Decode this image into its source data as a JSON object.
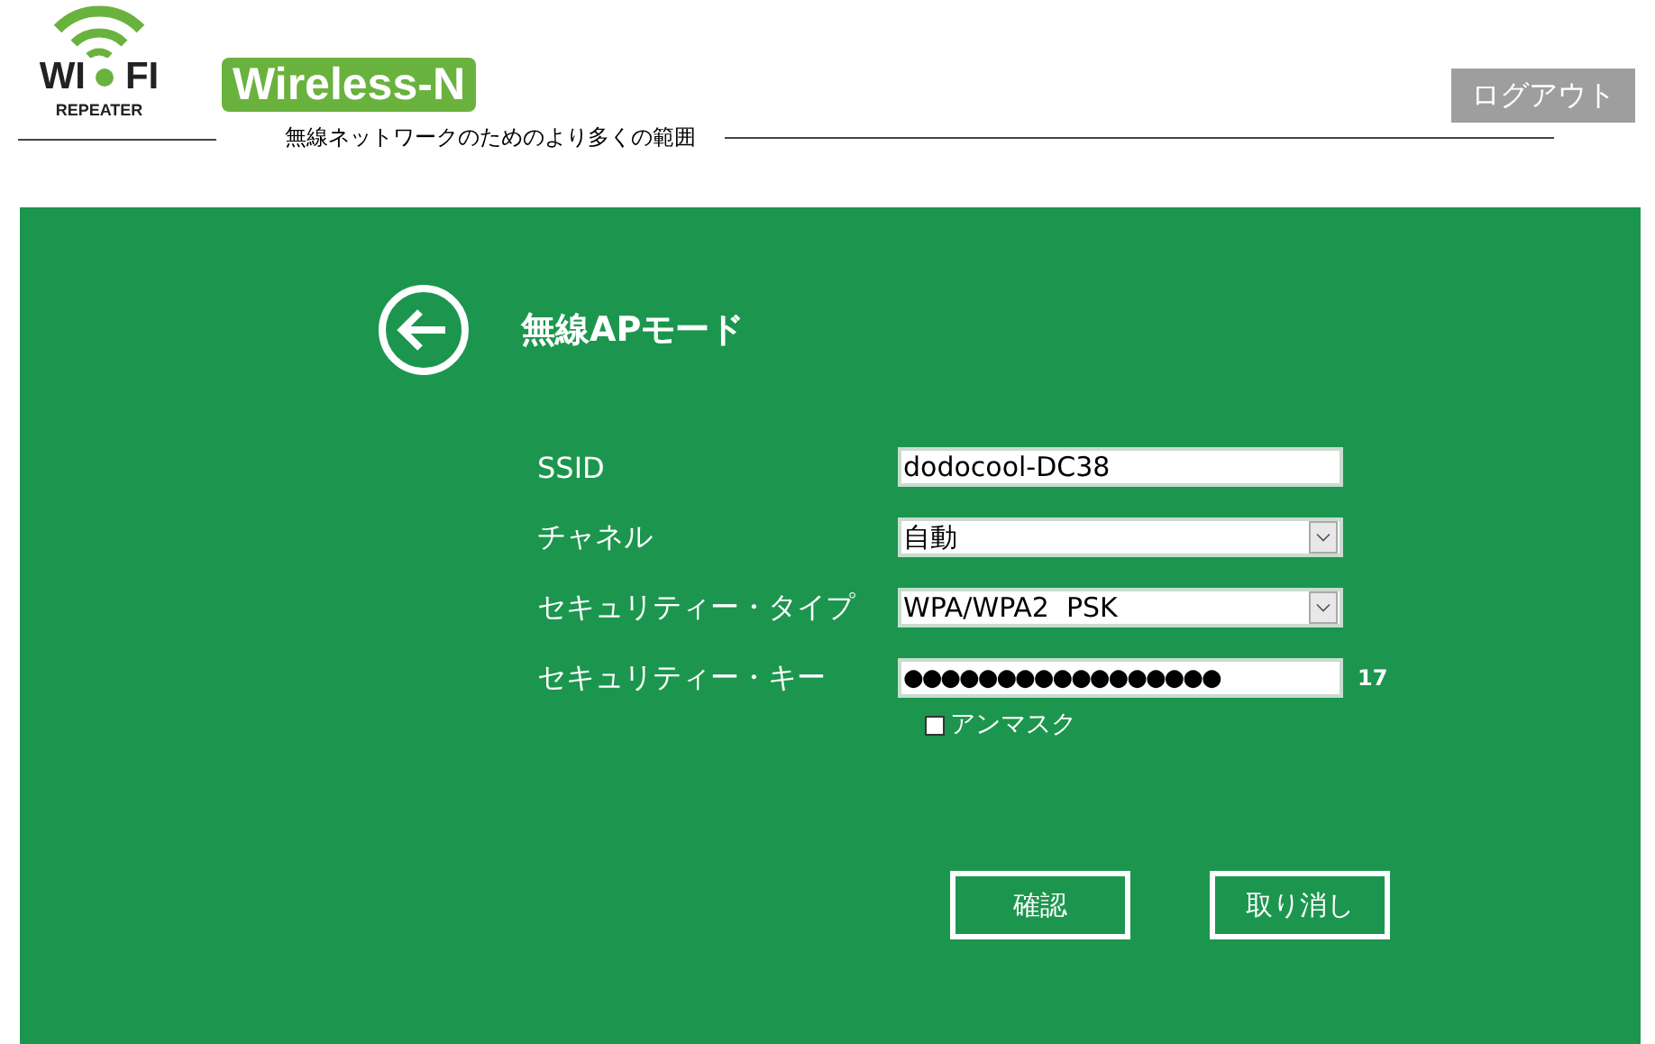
{
  "logo": {
    "left": "WI",
    "right": "FI",
    "sub": "REPEATER"
  },
  "badge": "Wireless-N",
  "tagline": "無線ネットワークのためのより多くの範囲",
  "logout": "ログアウト",
  "title": "無線APモード",
  "fields": [
    {
      "kind": "text",
      "label": "SSID",
      "value": "dodocool-DC38"
    },
    {
      "kind": "select",
      "label": "チャネル",
      "value": "自動"
    },
    {
      "kind": "select",
      "label": "セキュリティー・タイプ",
      "value": "WPA/WPA2  PSK"
    },
    {
      "kind": "password",
      "label": "セキュリティー・キー",
      "value": "●●●●●●●●●●●●●●●●●",
      "count": "17"
    }
  ],
  "unmask": {
    "label": "アンマスク",
    "checked": false
  },
  "buttons": [
    "確認",
    "取り消し"
  ]
}
